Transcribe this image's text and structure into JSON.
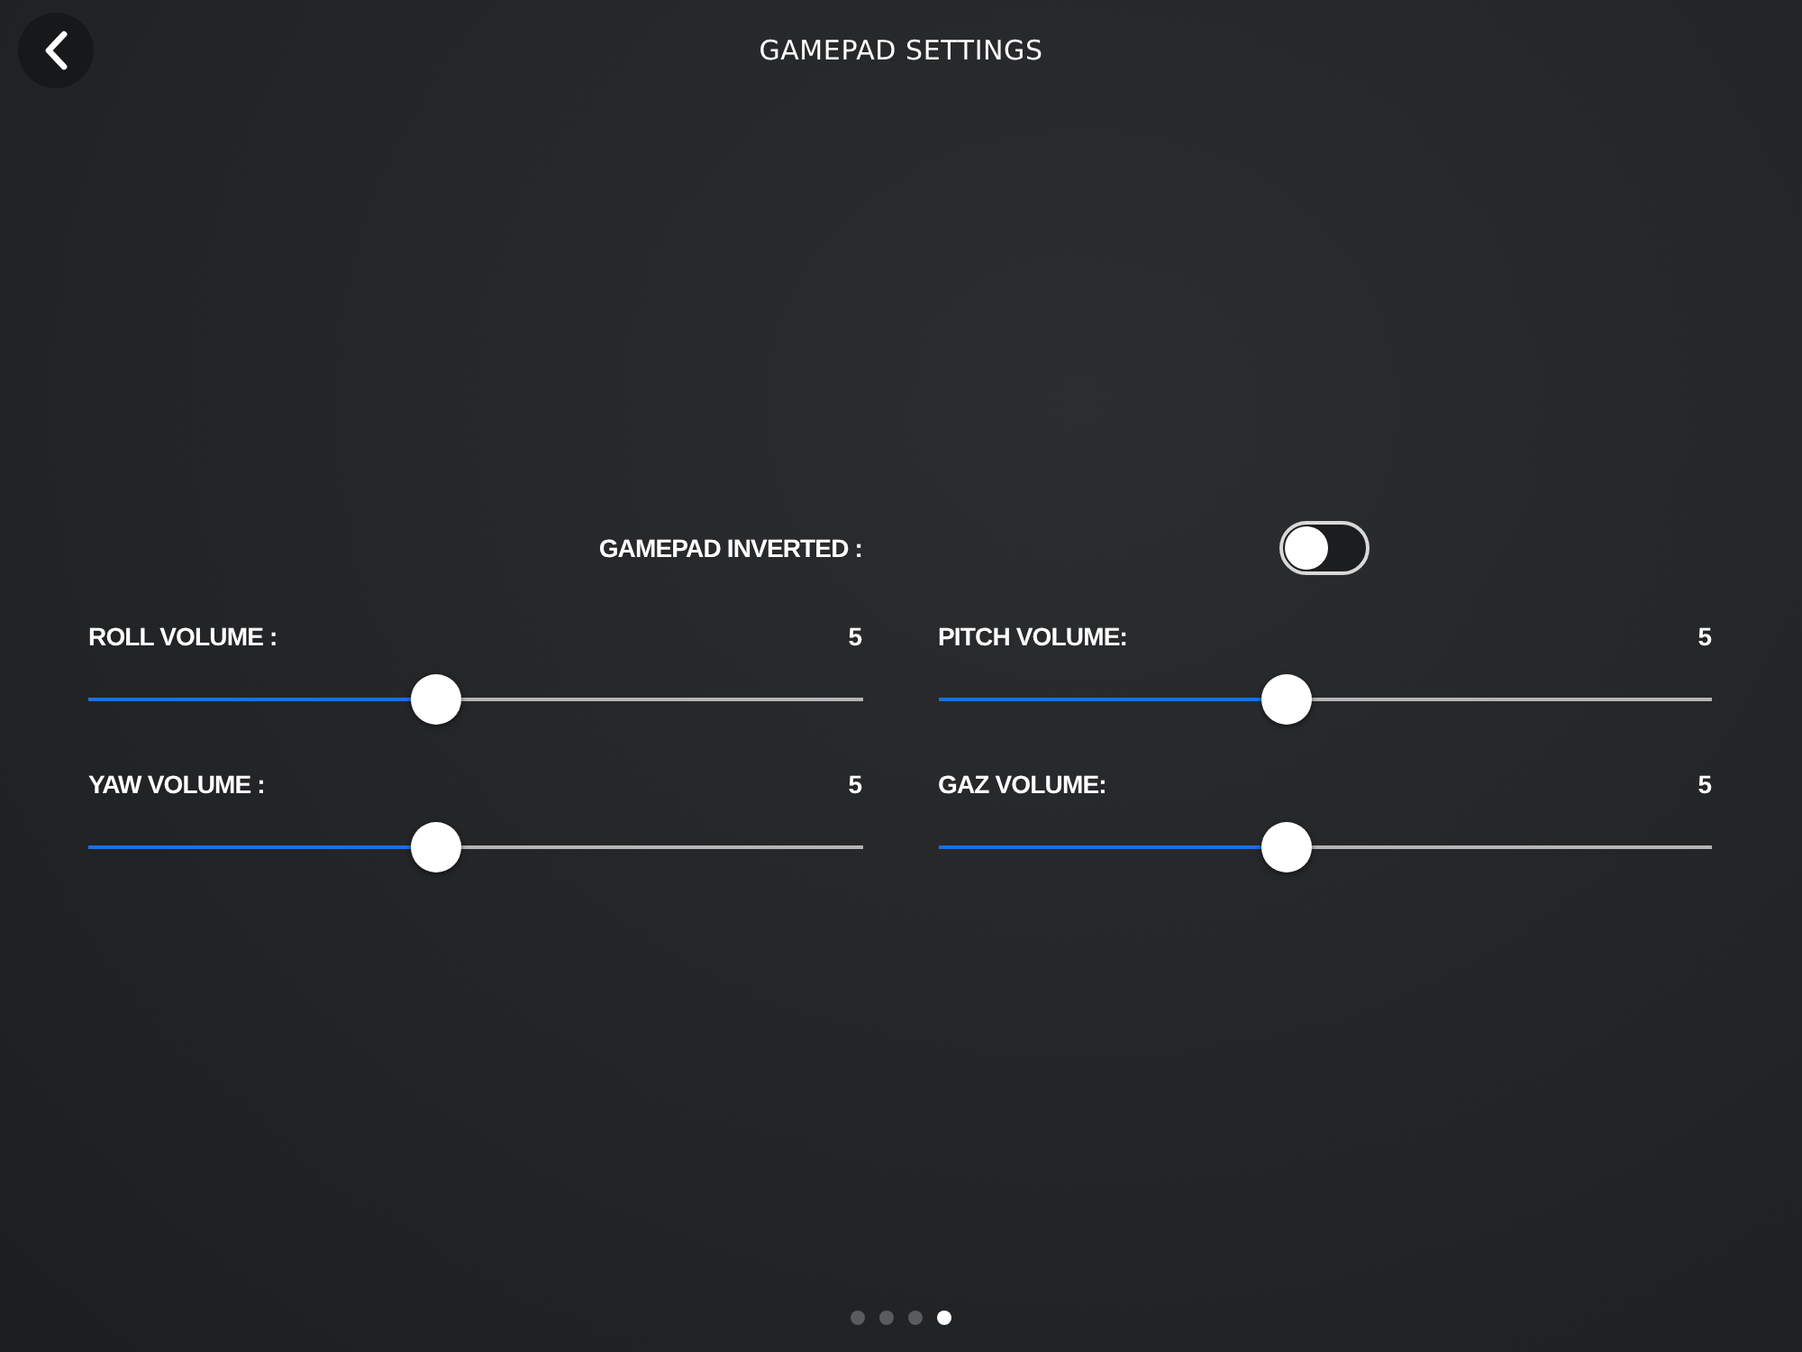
{
  "header": {
    "title": "GAMEPAD SETTINGS"
  },
  "toggle": {
    "label": "GAMEPAD INVERTED :",
    "on": false
  },
  "sliders": [
    {
      "label": "ROLL VOLUME :",
      "value": "5",
      "level": 0.45
    },
    {
      "label": "PITCH VOLUME:",
      "value": "5",
      "level": 0.45
    },
    {
      "label": "YAW VOLUME :",
      "value": "5",
      "level": 0.45
    },
    {
      "label": "GAZ VOLUME:",
      "value": "5",
      "level": 0.45
    }
  ],
  "pager": [
    {
      "selected": false
    },
    {
      "selected": false
    },
    {
      "selected": false
    },
    {
      "selected": true
    }
  ]
}
